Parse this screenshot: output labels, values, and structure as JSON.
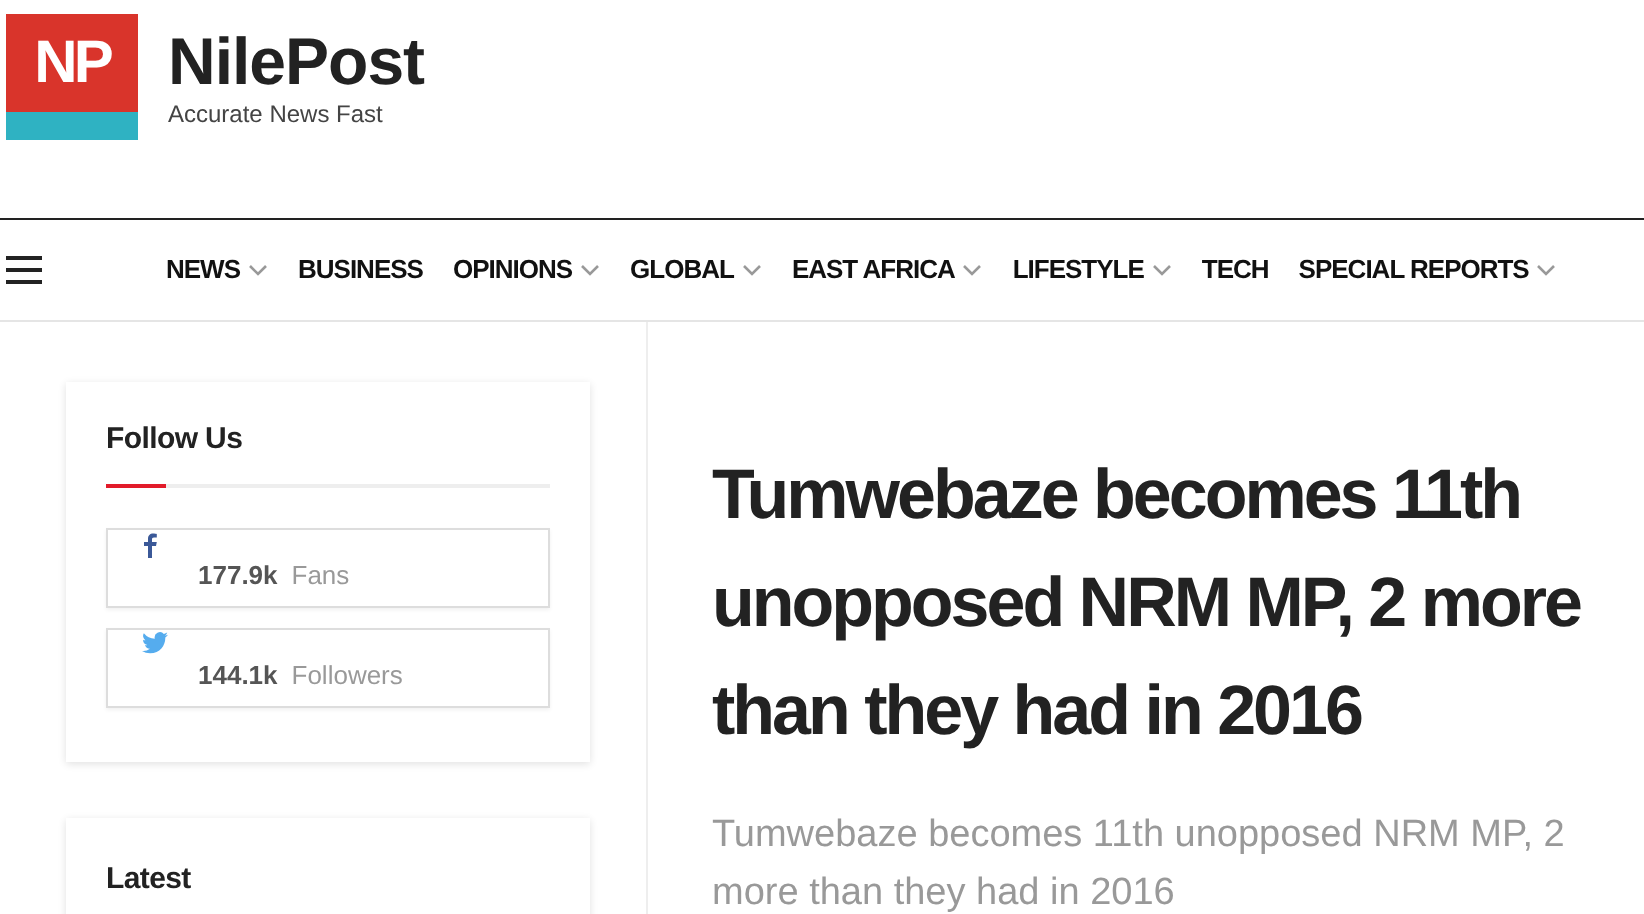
{
  "logo": {
    "mark": "NP",
    "name": "NilePost",
    "tagline": "Accurate News Fast"
  },
  "nav": {
    "items": [
      {
        "label": "NEWS",
        "dropdown": true
      },
      {
        "label": "BUSINESS",
        "dropdown": false
      },
      {
        "label": "OPINIONS",
        "dropdown": true
      },
      {
        "label": "GLOBAL",
        "dropdown": true
      },
      {
        "label": "EAST AFRICA",
        "dropdown": true
      },
      {
        "label": "LIFESTYLE",
        "dropdown": true
      },
      {
        "label": "TECH",
        "dropdown": false
      },
      {
        "label": "SPECIAL REPORTS",
        "dropdown": true
      }
    ]
  },
  "sidebar": {
    "follow": {
      "title": "Follow Us",
      "items": [
        {
          "kind": "facebook",
          "count": "177.9k",
          "label": "Fans"
        },
        {
          "kind": "twitter",
          "count": "144.1k",
          "label": "Followers"
        }
      ]
    },
    "latest": {
      "title": "Latest"
    }
  },
  "article": {
    "headline": "Tumwebaze becomes 11th unopposed NRM MP, 2 more than they had in 2016",
    "subtitle": "Tumwebaze becomes 11th unopposed NRM MP, 2 more than they had in 2016"
  }
}
